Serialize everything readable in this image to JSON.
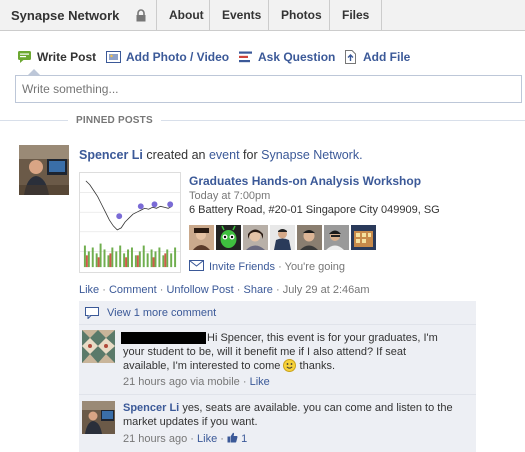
{
  "group": {
    "name": "Synapse Network"
  },
  "tabs": [
    {
      "label": "About"
    },
    {
      "label": "Events"
    },
    {
      "label": "Photos"
    },
    {
      "label": "Files"
    }
  ],
  "composer": {
    "actions": [
      {
        "label": "Write Post",
        "icon": "write-post-icon"
      },
      {
        "label": "Add Photo / Video",
        "icon": "photo-icon"
      },
      {
        "label": "Ask Question",
        "icon": "question-icon"
      },
      {
        "label": "Add File",
        "icon": "file-icon"
      }
    ],
    "placeholder": "Write something..."
  },
  "pinned_label": "PINNED POSTS",
  "story": {
    "author": "Spencer Li",
    "verb": "created an",
    "object": "event",
    "connector": "for",
    "target": "Synapse Network.",
    "event": {
      "title": "Graduates Hands-on Analysis Workshop",
      "time": "Today at 7:00pm",
      "address": "6 Battery Road, #20-01 Singapore City 049909, SG"
    },
    "invite_label": "Invite Friends",
    "going_text": "· You're going",
    "actions": {
      "like": "Like",
      "comment": "Comment",
      "unfollow": "Unfollow Post",
      "share": "Share",
      "timestamp": "July 29 at 2:46am",
      "dot": "·"
    }
  },
  "comments": {
    "view_more": "View 1 more comment",
    "items": [
      {
        "text_line1": "Hi Spencer, this event is for your graduates, I'm",
        "text_rest": "your student to be, will it benefit me if I also attend? If seat available, I'm interested to come",
        "text_end": "thanks.",
        "time": "21 hours ago via mobile",
        "like": "Like",
        "sep": "·"
      },
      {
        "author": "Spencer Li",
        "text": "yes, seats are available. you can come and listen to the market updates if you want.",
        "time": "21 hours ago",
        "like": "Like",
        "likes_count": "1",
        "sep": "·"
      }
    ]
  },
  "colors": {
    "link": "#3b5998",
    "nav_bg": "#f2f2f2",
    "comment_bg": "#edeff4"
  }
}
